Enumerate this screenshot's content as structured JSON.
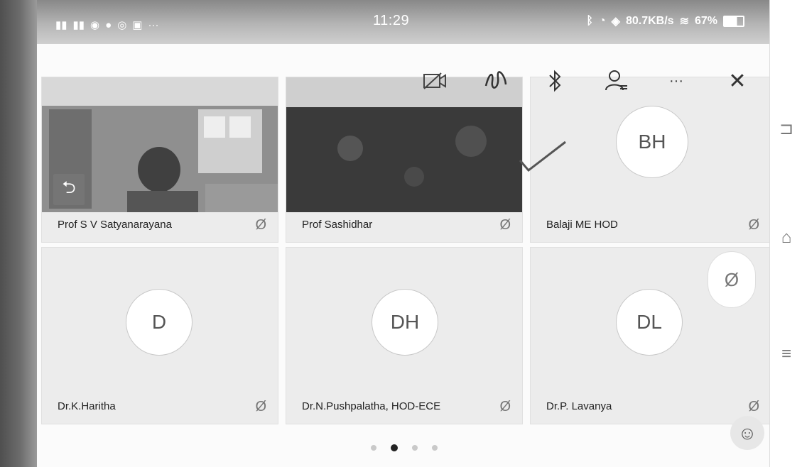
{
  "status_bar": {
    "time": "11:29",
    "left_icons": [
      "signal-4g-icon",
      "signal-4g-icon",
      "chat-icon",
      "message-icon",
      "vpn-icon",
      "mail-icon",
      "more-icon"
    ],
    "right_text": "80.7KB/s",
    "battery": "67%",
    "right_icons": [
      "bluetooth-icon",
      "alarm-icon",
      "data-icon",
      "wifi-icon"
    ]
  },
  "toolbar": {
    "camera_label": "",
    "draw_label": "",
    "bluetooth_label": "",
    "participants_label": "",
    "more_label": "···",
    "close_label": "✕"
  },
  "tiles": [
    {
      "name": "Prof S V Satyanarayana",
      "initials": "",
      "has_video": true
    },
    {
      "name": "Prof Sashidhar",
      "initials": "",
      "has_video": true
    },
    {
      "name": "Balaji ME HOD",
      "initials": "BH",
      "has_video": false
    },
    {
      "name": "Dr.K.Haritha",
      "initials": "D",
      "has_video": false
    },
    {
      "name": "Dr.N.Pushpalatha, HOD-ECE",
      "initials": "DH",
      "has_video": false
    },
    {
      "name": "Dr.P. Lavanya",
      "initials": "DL",
      "has_video": false
    }
  ],
  "pager": {
    "pages": 4,
    "active": 1
  },
  "colors": {
    "accent": "#222222",
    "tile_bg": "#ececec",
    "muted_icon": "#777777"
  }
}
